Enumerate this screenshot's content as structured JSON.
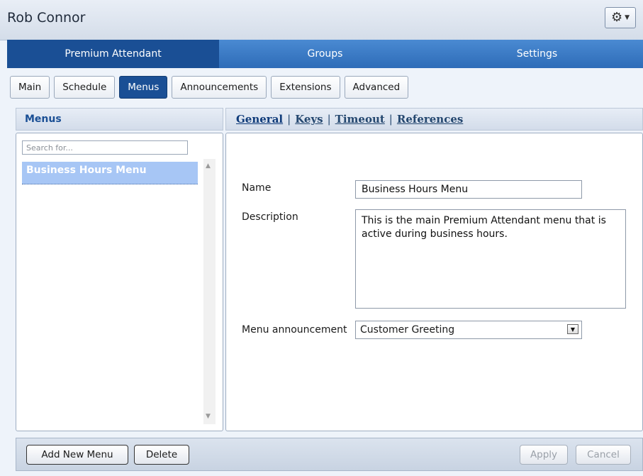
{
  "header": {
    "user_name": "Rob Connor",
    "settings_icon": "gear-icon"
  },
  "topnav": [
    {
      "label": "Premium Attendant",
      "active": true
    },
    {
      "label": "Groups",
      "active": false
    },
    {
      "label": "Settings",
      "active": false
    }
  ],
  "subtabs": [
    {
      "label": "Main",
      "active": false
    },
    {
      "label": "Schedule",
      "active": false
    },
    {
      "label": "Menus",
      "active": true
    },
    {
      "label": "Announcements",
      "active": false
    },
    {
      "label": "Extensions",
      "active": false
    },
    {
      "label": "Advanced",
      "active": false
    }
  ],
  "left_panel": {
    "title": "Menus",
    "search": {
      "placeholder": "Search for...",
      "value": ""
    },
    "items": [
      {
        "label": "Business Hours Menu",
        "selected": true
      }
    ]
  },
  "right_panel": {
    "tabs": [
      {
        "label": "General",
        "active": true
      },
      {
        "label": "Keys",
        "active": false
      },
      {
        "label": "Timeout",
        "active": false
      },
      {
        "label": "References",
        "active": false
      }
    ],
    "form": {
      "name_label": "Name",
      "name_value": "Business Hours Menu",
      "description_label": "Description",
      "description_value": "This is the main Premium Attendant menu that is active during business hours.",
      "announcement_label": "Menu announcement",
      "announcement_value": "Customer Greeting"
    }
  },
  "footer": {
    "add_label": "Add New Menu",
    "delete_label": "Delete",
    "apply_label": "Apply",
    "cancel_label": "Cancel"
  },
  "colors": {
    "nav_active": "#1a4f95",
    "nav_bg": "#3d7cc9",
    "selection": "#a7c6f5"
  }
}
